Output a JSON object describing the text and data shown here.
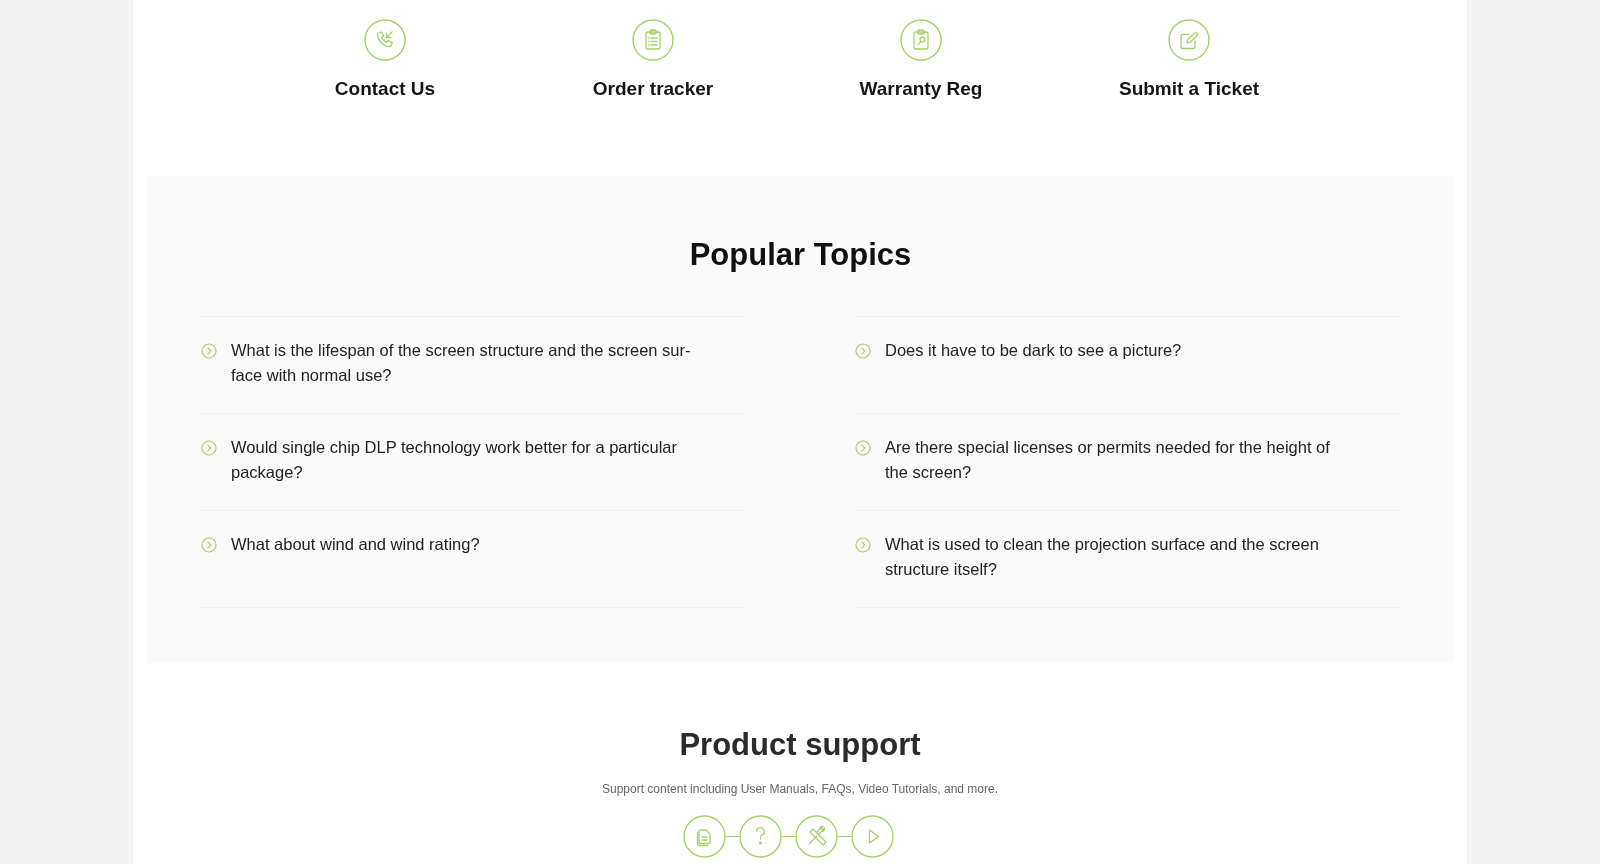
{
  "quick_links": [
    {
      "label": "Contact Us"
    },
    {
      "label": "Order tracker"
    },
    {
      "label": "Warranty Reg"
    },
    {
      "label": "Submit a Ticket"
    }
  ],
  "popular_topics": {
    "title": "Popular Topics",
    "topics": [
      "What is the lifespan of the screen structure and the screen sur-face with normal use?",
      "Does it have to be dark to see a picture?",
      "Would single chip DLP technology work better for a particular package?",
      "Are there special licenses or permits needed for the height of the screen?",
      "What about wind and wind rating?",
      "What is used to clean the projection surface and the screen structure itself?"
    ]
  },
  "product_support": {
    "title": "Product support",
    "subtitle": "Support content including User Manuals, FAQs, Video Tutorials, and more."
  }
}
